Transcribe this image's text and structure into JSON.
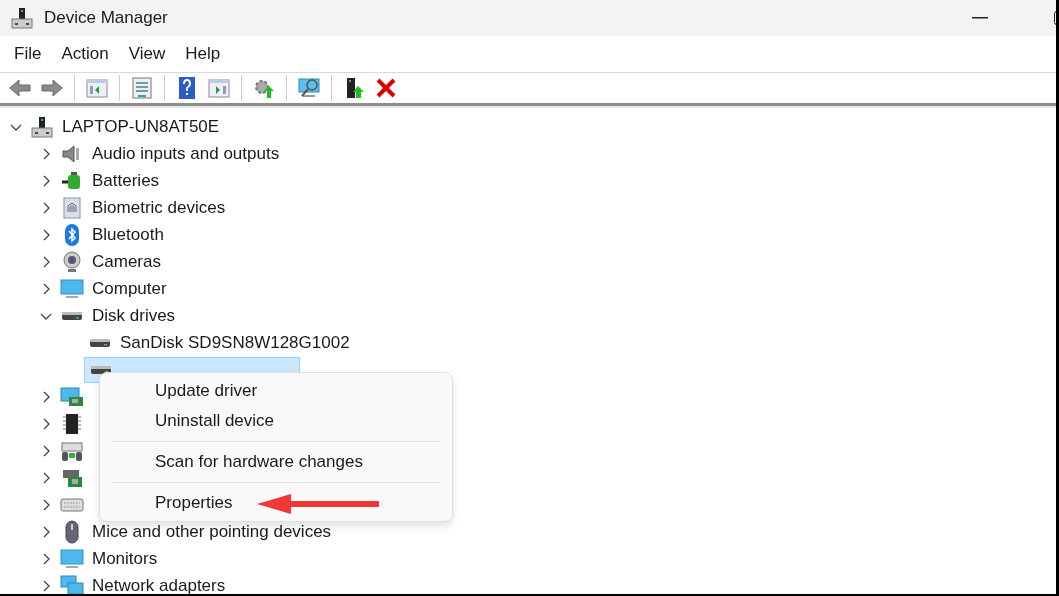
{
  "window": {
    "title": "Device Manager"
  },
  "menu_bar": [
    "File",
    "Action",
    "View",
    "Help"
  ],
  "tree": {
    "label": "LAPTOP-UN8AT50E",
    "expanded": true,
    "selected": false,
    "children": [
      {
        "label": "Audio inputs and outputs",
        "expanded": false,
        "selected": false
      },
      {
        "label": "Batteries",
        "expanded": false,
        "selected": false
      },
      {
        "label": "Biometric devices",
        "expanded": false,
        "selected": false
      },
      {
        "label": "Bluetooth",
        "expanded": false,
        "selected": false
      },
      {
        "label": "Cameras",
        "expanded": false,
        "selected": false
      },
      {
        "label": "Computer",
        "expanded": false,
        "selected": false
      },
      {
        "label": "Disk drives",
        "expanded": true,
        "selected": false,
        "children": [
          {
            "label": "SanDisk SD9SN8W128G1002",
            "selected": false
          },
          {
            "selected": true
          }
        ]
      },
      {
        "expanded": false,
        "selected": false
      },
      {
        "expanded": false,
        "selected": false
      },
      {
        "expanded": false,
        "selected": false
      },
      {
        "expanded": false,
        "selected": false
      },
      {
        "expanded": false,
        "selected": false
      },
      {
        "label": "Mice and other pointing devices",
        "expanded": false,
        "selected": false
      },
      {
        "label": "Monitors",
        "expanded": false,
        "selected": false
      },
      {
        "label": "Network adapters",
        "expanded": false,
        "selected": false
      }
    ]
  },
  "context_menu": [
    {
      "kind": "item",
      "label": "Update driver"
    },
    {
      "kind": "item",
      "label": "Uninstall device"
    },
    {
      "kind": "separator"
    },
    {
      "kind": "item",
      "label": "Scan for hardware changes"
    },
    {
      "kind": "separator"
    },
    {
      "kind": "item",
      "label": "Properties"
    }
  ]
}
